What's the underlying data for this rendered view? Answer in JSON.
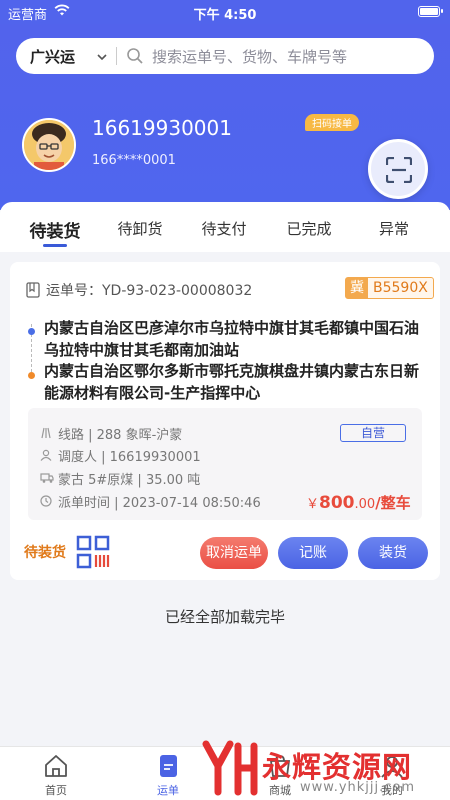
{
  "status_bar": {
    "carrier": "运营商",
    "time": "下午 4:50"
  },
  "search": {
    "city": "广兴运",
    "placeholder": "搜索运单号、货物、车牌号等"
  },
  "profile": {
    "phone": "16619930001",
    "masked_phone": "166****0001",
    "scan_tag": "扫码接单"
  },
  "tabs": [
    {
      "label": "待装货",
      "active": true
    },
    {
      "label": "待卸货",
      "active": false
    },
    {
      "label": "待支付",
      "active": false
    },
    {
      "label": "已完成",
      "active": false
    },
    {
      "label": "异常",
      "active": false
    }
  ],
  "order": {
    "waybill_label": "运单号：YD-93-023-00008032",
    "plate_province": "冀",
    "plate_number": "B5590X",
    "from_address": "内蒙古自治区巴彦淖尔市乌拉特中旗甘其毛都镇中国石油乌拉特中旗甘其毛都南加油站",
    "to_address": "内蒙古自治区鄂尔多斯市鄂托克旗棋盘井镇内蒙古东日新能源材料有限公司-生产指挥中心",
    "route": "线路 | 288 象晖-沪蒙",
    "dispatcher": "调度人 | 16619930001",
    "cargo": "蒙古 5#原煤 | 35.00 吨",
    "dispatch_time": "派单时间 | 2023-07-14 08:50:46",
    "self_operated": "自营",
    "price_symbol": "￥",
    "price_int": "800",
    "price_dec": ".00",
    "price_unit": "/整车",
    "status": "待装货",
    "buttons": {
      "cancel": "取消运单",
      "account": "记账",
      "load": "装货"
    }
  },
  "footer_note": "已经全部加载完毕",
  "nav": [
    {
      "label": "首页",
      "icon": "home-icon"
    },
    {
      "label": "运单",
      "icon": "waybill-icon",
      "active": true
    },
    {
      "label": "商城",
      "icon": "mall-icon"
    },
    {
      "label": "我的",
      "icon": "user-icon"
    }
  ],
  "watermark": {
    "text": "永辉资源网",
    "url": "www.yhkjjj.com"
  },
  "colors": {
    "primary": "#4f66ee",
    "orange": "#e07a1b",
    "red": "#e84b3c"
  }
}
